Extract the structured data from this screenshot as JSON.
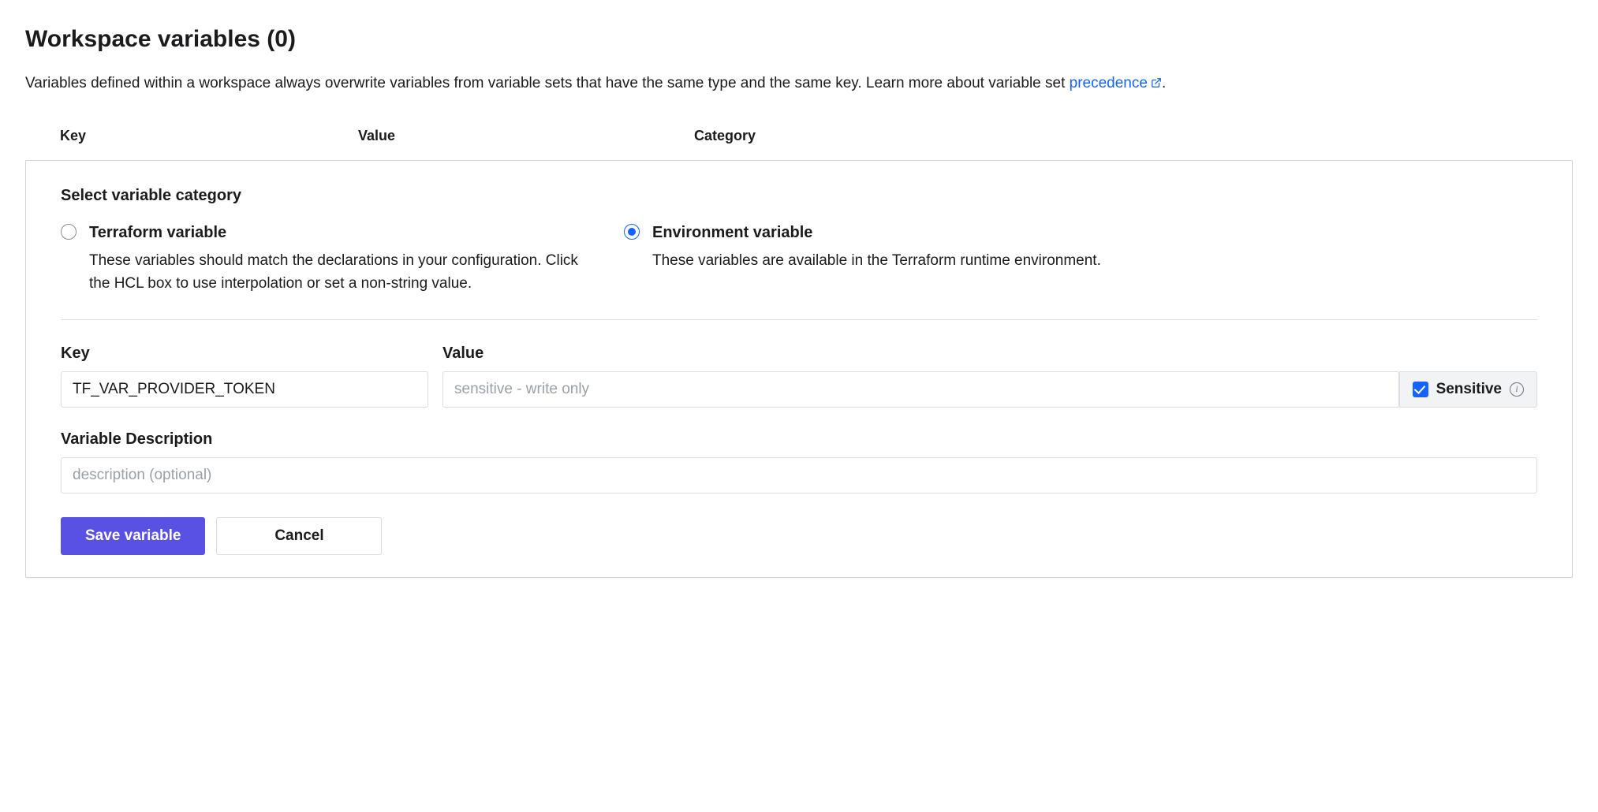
{
  "title": "Workspace variables (0)",
  "intro": {
    "text_before": "Variables defined within a workspace always overwrite variables from variable sets that have the same type and the same key. Learn more about variable set ",
    "link_text": "precedence",
    "text_after": "."
  },
  "columns": {
    "key": "Key",
    "value": "Value",
    "category": "Category"
  },
  "category": {
    "section_title": "Select variable category",
    "options": {
      "terraform": {
        "label": "Terraform variable",
        "desc": "These variables should match the declarations in your configuration. Click the HCL box to use interpolation or set a non-string value.",
        "selected": false
      },
      "environment": {
        "label": "Environment variable",
        "desc": "These variables are available in the Terraform runtime environment.",
        "selected": true
      }
    }
  },
  "form": {
    "key_label": "Key",
    "key_value": "TF_VAR_PROVIDER_TOKEN",
    "value_label": "Value",
    "value_placeholder": "sensitive - write only",
    "value_value": "",
    "sensitive_label": "Sensitive",
    "sensitive_checked": true,
    "desc_label": "Variable Description",
    "desc_placeholder": "description (optional)",
    "desc_value": ""
  },
  "buttons": {
    "save": "Save variable",
    "cancel": "Cancel"
  }
}
